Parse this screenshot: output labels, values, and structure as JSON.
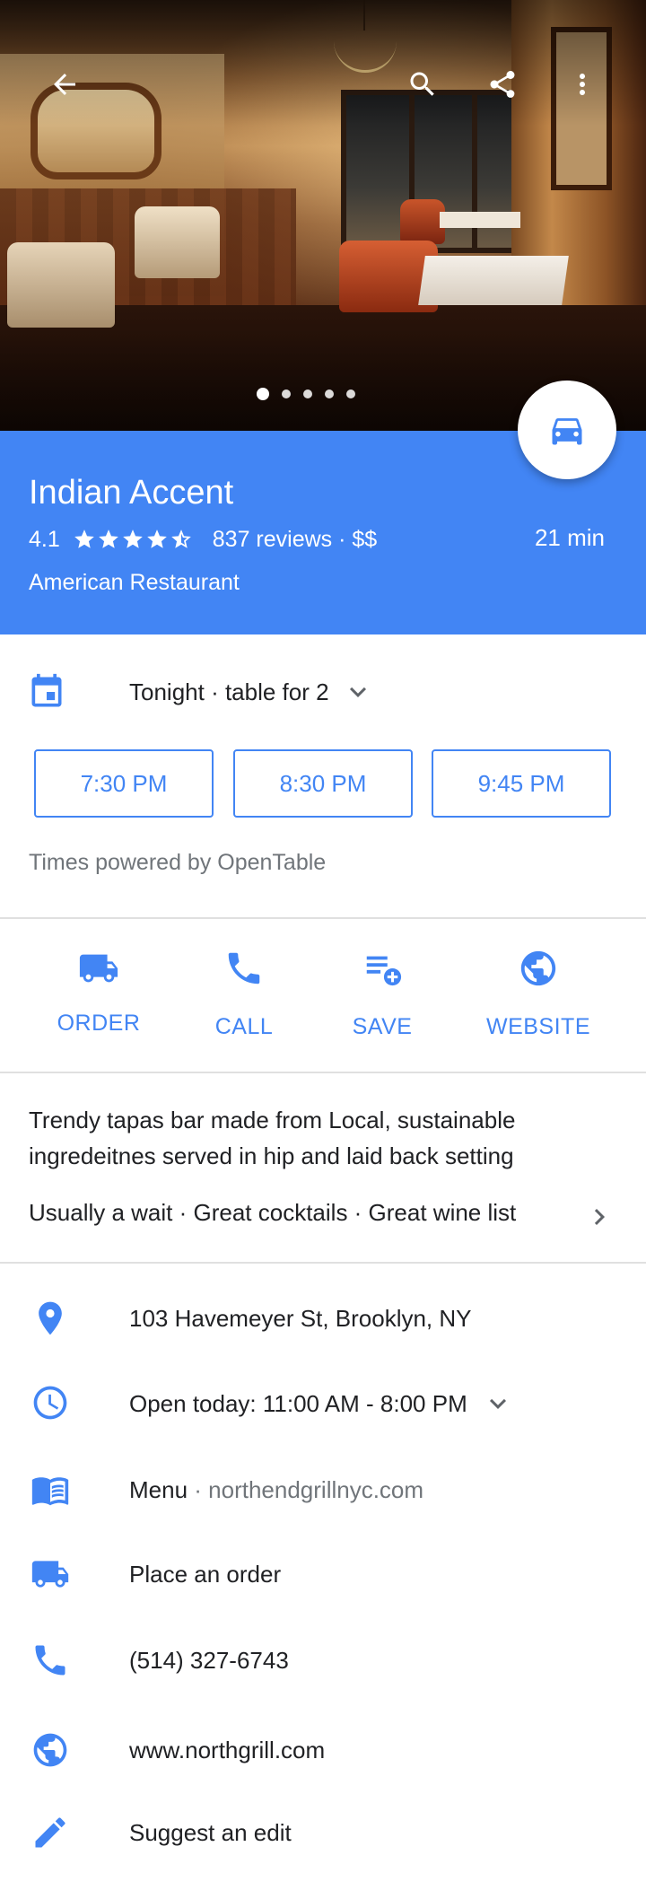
{
  "hero": {
    "photo_count": 5,
    "active_photo": 1
  },
  "toolbar": {
    "back_icon": "arrow-back-icon",
    "search_icon": "search-icon",
    "share_icon": "share-icon",
    "more_icon": "more-vert-icon"
  },
  "place": {
    "name": "Indian Accent",
    "rating": "4.1",
    "rating_value": 4.1,
    "rating_max": 5,
    "reviews": "837 reviews",
    "price": "$$",
    "rating_line_suffix": "837 reviews · $$",
    "category": "American Restaurant",
    "drive_time": "21 min",
    "header_color": "#4285f4"
  },
  "directions_fab": {
    "icon": "car-icon"
  },
  "reservation": {
    "party": "Tonight · table for 2",
    "times": [
      "7:30 PM",
      "8:30 PM",
      "9:45 PM"
    ],
    "powered_by": "Times powered by OpenTable"
  },
  "actions": {
    "order": "ORDER",
    "call": "CALL",
    "save": "SAVE",
    "website": "WEBSITE"
  },
  "description": {
    "text": "Trendy tapas bar made from Local, sustainable ingredeitnes served in hip and laid back setting",
    "highlights": "Usually a wait · Great cocktails · Great wine list"
  },
  "info": {
    "address": "103 Havemeyer St, Brooklyn, NY",
    "hours": "Open today: 11:00 AM - 8:00 PM",
    "menu_label": "Menu",
    "menu_sep": " · ",
    "menu_site": "northendgrillnyc.com",
    "order": "Place an order",
    "phone": "(514) 327-6743",
    "website": "www.northgrill.com",
    "suggest": "Suggest an edit"
  },
  "colors": {
    "accent": "#4285f4",
    "text": "#202124",
    "muted": "#70757a",
    "divider": "#e0e0e0"
  }
}
